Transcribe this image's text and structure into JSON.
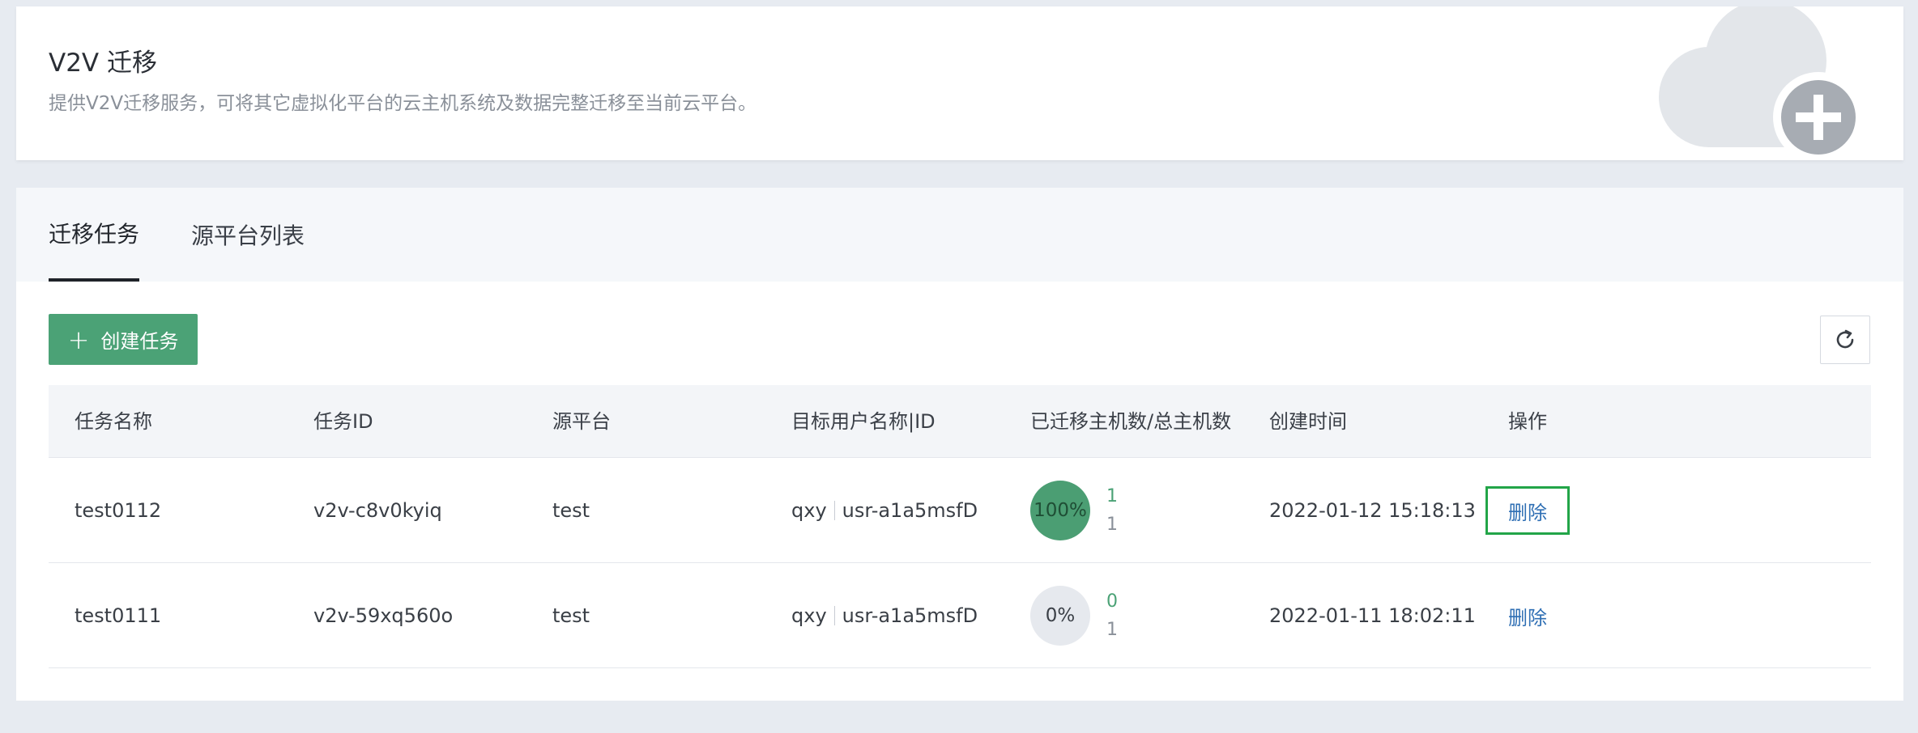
{
  "header": {
    "title": "V2V 迁移",
    "description": "提供V2V迁移服务，可将其它虚拟化平台的云主机系统及数据完整迁移至当前云平台。",
    "illustration_icon": "cloud-plus-icon"
  },
  "tabs": [
    {
      "label": "迁移任务",
      "active": true
    },
    {
      "label": "源平台列表",
      "active": false
    }
  ],
  "toolbar": {
    "create_icon": "plus-icon",
    "create_label": "创建任务",
    "refresh_icon": "refresh-icon"
  },
  "table": {
    "columns": [
      "任务名称",
      "任务ID",
      "源平台",
      "目标用户名称|ID",
      "已迁移主机数/总主机数",
      "创建时间",
      "操作"
    ],
    "rows": [
      {
        "name": "test0112",
        "id": "v2v-c8v0kyiq",
        "source": "test",
        "user_name": "qxy",
        "user_id": "usr-a1a5msfD",
        "progress_label": "100%",
        "progress": 1.0,
        "migrated": "1",
        "total": "1",
        "created": "2022-01-12 15:18:13",
        "action": "删除"
      },
      {
        "name": "test0111",
        "id": "v2v-59xq560o",
        "source": "test",
        "user_name": "qxy",
        "user_id": "usr-a1a5msfD",
        "progress_label": "0%",
        "progress": 0.0,
        "migrated": "0",
        "total": "1",
        "created": "2022-01-11 18:02:11",
        "action": "删除"
      }
    ]
  },
  "colors": {
    "primary_green": "#4ba276",
    "link_blue": "#2f6fb4",
    "focus_outline": "#22a548"
  }
}
